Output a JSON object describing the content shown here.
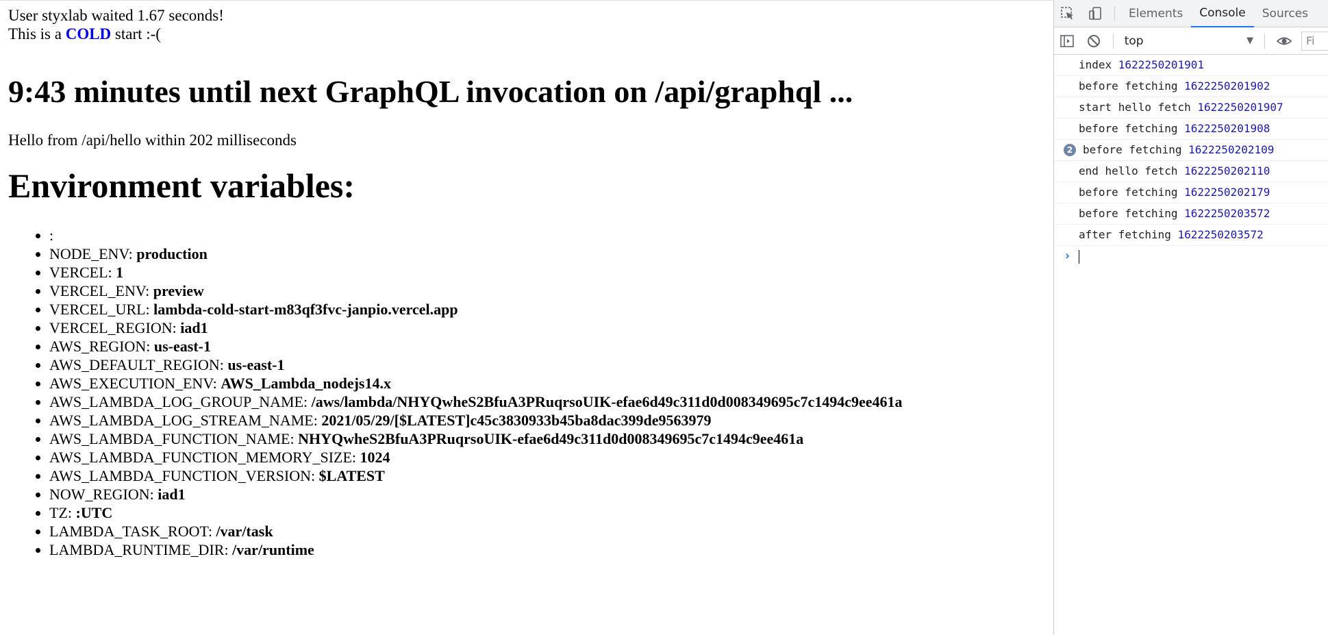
{
  "page": {
    "waited_text": "User styxlab waited 1.67 seconds!",
    "cold_prefix": "This is a ",
    "cold_word": "COLD",
    "cold_suffix": " start :-(",
    "countdown": "9:43 minutes until next GraphQL invocation on /api/graphql ...",
    "hello": "Hello from /api/hello within 202 milliseconds",
    "env_title": "Environment variables:",
    "env": [
      {
        "key": ":",
        "value": ""
      },
      {
        "key": "NODE_ENV: ",
        "value": "production"
      },
      {
        "key": "VERCEL: ",
        "value": "1"
      },
      {
        "key": "VERCEL_ENV: ",
        "value": "preview"
      },
      {
        "key": "VERCEL_URL: ",
        "value": "lambda-cold-start-m83qf3fvc-janpio.vercel.app"
      },
      {
        "key": "VERCEL_REGION: ",
        "value": "iad1"
      },
      {
        "key": "AWS_REGION: ",
        "value": "us-east-1"
      },
      {
        "key": "AWS_DEFAULT_REGION: ",
        "value": "us-east-1"
      },
      {
        "key": "AWS_EXECUTION_ENV: ",
        "value": "AWS_Lambda_nodejs14.x"
      },
      {
        "key": "AWS_LAMBDA_LOG_GROUP_NAME: ",
        "value": "/aws/lambda/NHYQwheS2BfuA3PRuqrsoUIK-efae6d49c311d0d008349695c7c1494c9ee461a"
      },
      {
        "key": "AWS_LAMBDA_LOG_STREAM_NAME: ",
        "value": "2021/05/29/[$LATEST]c45c3830933b45ba8dac399de9563979"
      },
      {
        "key": "AWS_LAMBDA_FUNCTION_NAME: ",
        "value": "NHYQwheS2BfuA3PRuqrsoUIK-efae6d49c311d0d008349695c7c1494c9ee461a"
      },
      {
        "key": "AWS_LAMBDA_FUNCTION_MEMORY_SIZE: ",
        "value": "1024"
      },
      {
        "key": "AWS_LAMBDA_FUNCTION_VERSION: ",
        "value": "$LATEST"
      },
      {
        "key": "NOW_REGION: ",
        "value": "iad1"
      },
      {
        "key": "TZ: ",
        "value": ":UTC"
      },
      {
        "key": "LAMBDA_TASK_ROOT: ",
        "value": "/var/task"
      },
      {
        "key": "LAMBDA_RUNTIME_DIR: ",
        "value": "/var/runtime"
      }
    ]
  },
  "devtools": {
    "icons": {
      "inspect": "inspect-element-icon",
      "device": "device-toolbar-icon",
      "sidebar": "console-sidebar-icon",
      "clear": "clear-console-icon",
      "eye": "live-expression-eye-icon"
    },
    "tabs": {
      "elements": "Elements",
      "console": "Console",
      "sources": "Sources"
    },
    "context": "top",
    "filter": "Fi",
    "accent_color": "#1a73e8",
    "timestamp_color": "#1a1aa6",
    "console_messages": [
      {
        "text": "index ",
        "ts": "1622250201901",
        "count": ""
      },
      {
        "text": "before fetching ",
        "ts": "1622250201902",
        "count": ""
      },
      {
        "text": "start hello fetch ",
        "ts": "1622250201907",
        "count": ""
      },
      {
        "text": "before fetching ",
        "ts": "1622250201908",
        "count": ""
      },
      {
        "text": "before fetching ",
        "ts": "1622250202109",
        "count": "2"
      },
      {
        "text": "end hello fetch ",
        "ts": "1622250202110",
        "count": ""
      },
      {
        "text": "before fetching ",
        "ts": "1622250202179",
        "count": ""
      },
      {
        "text": "before fetching ",
        "ts": "1622250203572",
        "count": ""
      },
      {
        "text": "after fetching ",
        "ts": "1622250203572",
        "count": ""
      }
    ]
  }
}
